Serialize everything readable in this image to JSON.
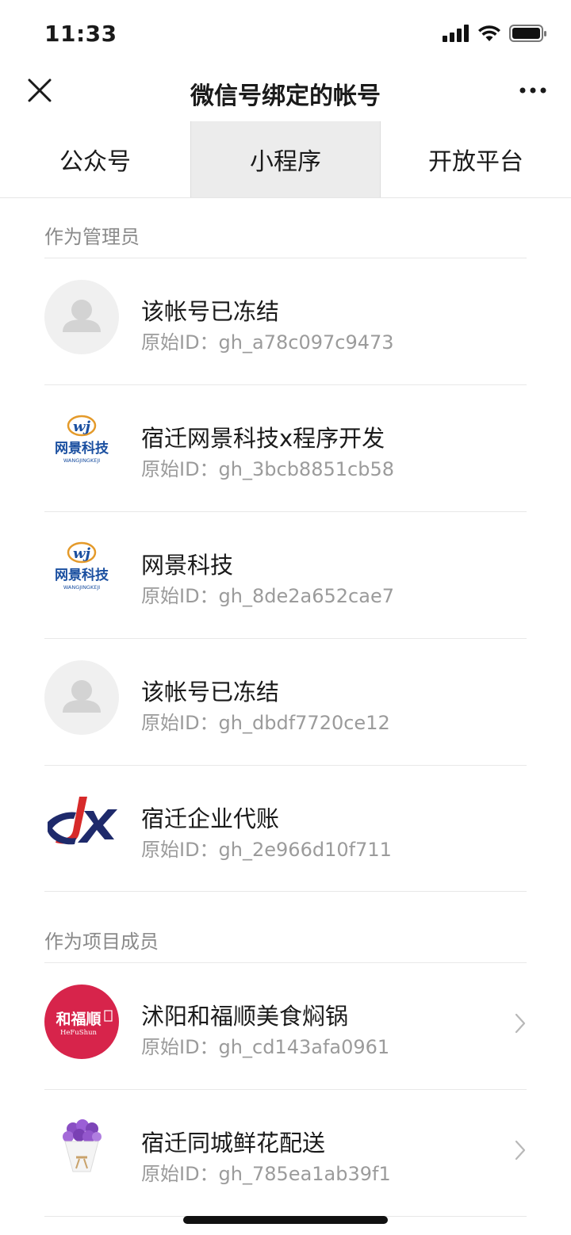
{
  "status": {
    "time": "11:33"
  },
  "nav": {
    "title": "微信号绑定的帐号"
  },
  "tabs": [
    {
      "label": "公众号",
      "active": false
    },
    {
      "label": "小程序",
      "active": true
    },
    {
      "label": "开放平台",
      "active": false
    }
  ],
  "sections": {
    "admin": {
      "title": "作为管理员"
    },
    "member": {
      "title": "作为项目成员"
    }
  },
  "admin_accounts": [
    {
      "name": "该帐号已冻结",
      "id": "原始ID：gh_a78c097c9473",
      "avatar": "default-avatar-icon"
    },
    {
      "name": "宿迁网景科技x程序开发",
      "id": "原始ID：gh_3bcb8851cb58",
      "avatar": "wangjing-logo",
      "logo_text": "网景科技",
      "logo_sub": "WANGJINGKEJI",
      "logo_mark": "wj"
    },
    {
      "name": "网景科技",
      "id": "原始ID：gh_8de2a652cae7",
      "avatar": "wangjing-logo",
      "logo_text": "网景科技",
      "logo_sub": "WANGJINGKEJI",
      "logo_mark": "wj"
    },
    {
      "name": "该帐号已冻结",
      "id": "原始ID：gh_dbdf7720ce12",
      "avatar": "default-avatar-icon"
    },
    {
      "name": "宿迁企业代账",
      "id": "原始ID：gh_2e966d10f711",
      "avatar": "jx-logo"
    }
  ],
  "member_accounts": [
    {
      "name": "沭阳和福顺美食焖锅",
      "id": "原始ID：gh_cd143afa0961",
      "avatar": "hefushun-logo",
      "logo_text": "和福順",
      "logo_sub": "HeFuShun"
    },
    {
      "name": "宿迁同城鲜花配送",
      "id": "原始ID：gh_785ea1ab39f1",
      "avatar": "flower-bouquet-image"
    }
  ],
  "colors": {
    "accent_active_tab": "#ececec",
    "secondary_text": "#9b9b9b",
    "hefushun_red": "#d7244b",
    "wangjing_blue": "#1a4fa0"
  }
}
